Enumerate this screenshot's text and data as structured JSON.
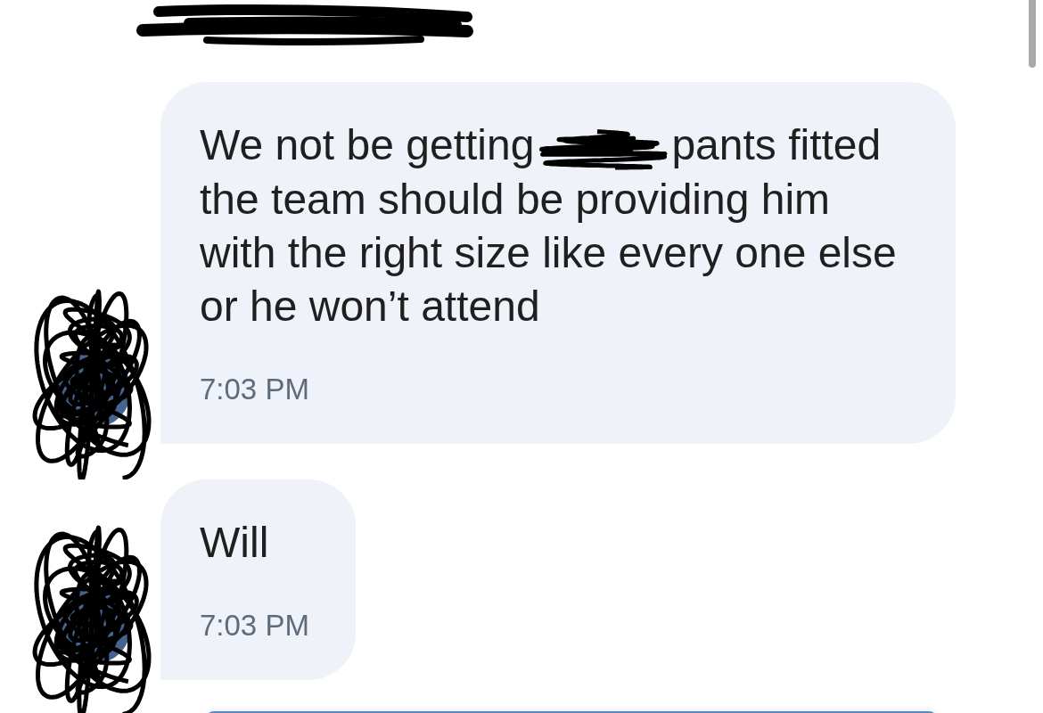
{
  "messages": [
    {
      "segments": [
        {
          "kind": "text",
          "text": "We not be getting"
        },
        {
          "kind": "redacted"
        },
        {
          "kind": "text",
          "text": "pants fitted"
        },
        {
          "kind": "paragraph",
          "text": "the team should be providing him with the right size like every one else or he won’t attend"
        }
      ],
      "time": "7:03 PM"
    },
    {
      "segments": [
        {
          "kind": "paragraph",
          "text": "Will"
        }
      ],
      "time": "7:03 PM"
    }
  ]
}
